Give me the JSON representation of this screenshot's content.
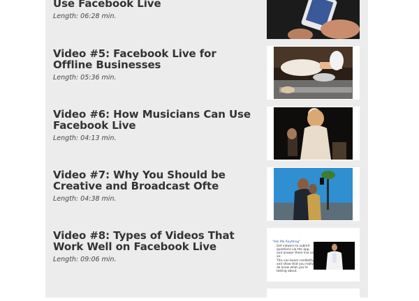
{
  "videos": [
    {
      "title": "Use Facebook Live",
      "length": "Length: 06:28 min."
    },
    {
      "title": "Video #5: Facebook Live for Offline Businesses",
      "length": "Length: 05:36 min."
    },
    {
      "title": "Video #6: How Musicians Can Use Facebook Live",
      "length": "Length: 04:13 min."
    },
    {
      "title": "Video #7: Why You Should be Creative and Broadcast Ofte",
      "length": "Length: 04:38 min."
    },
    {
      "title": "Video #8: Types of Videos That Work Well on Facebook Live",
      "length": "Length: 09:06 min."
    }
  ],
  "slide": {
    "heading": "\"Ask Me Anything\"",
    "bullets": [
      "Get viewers to submit questions via the app, and answer them live on air.",
      "This can boost credibility and show that you really do know what you're talking about."
    ]
  },
  "colors": {
    "panel_bg": "#ececec",
    "title_text": "#333333"
  }
}
